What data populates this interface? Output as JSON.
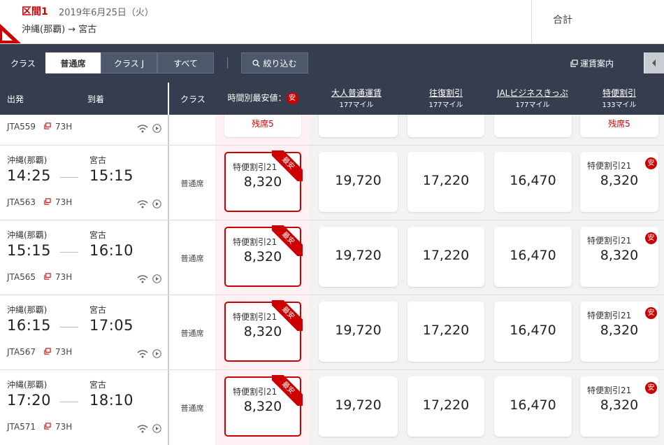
{
  "header": {
    "section": "区間1",
    "date": "2019年6月25日（火）",
    "route": "沖縄(那覇) → 宮古",
    "total_label": "合計"
  },
  "toolbar": {
    "class_label": "クラス",
    "class_options": [
      {
        "label": "普通席",
        "selected": true
      },
      {
        "label": "クラス J",
        "selected": false
      },
      {
        "label": "すべて",
        "selected": false
      }
    ],
    "filter_label": "絞り込む",
    "fare_info_label": "運賃案内"
  },
  "columns": {
    "depart": "出発",
    "arrive": "到着",
    "class": "クラス",
    "lowest": "時間別最安値：",
    "lowest_badge": "安",
    "fares": [
      {
        "name": "大人普通運賃",
        "miles": "177マイル"
      },
      {
        "name": "往復割引",
        "miles": "177マイル"
      },
      {
        "name": "JALビジネスきっぷ",
        "miles": "177マイル"
      },
      {
        "name": "特便割引",
        "miles": "133マイル"
      }
    ]
  },
  "partial_row": {
    "flight": "JTA559",
    "aircraft": "73H",
    "lowest_remaining": "残席5",
    "special_remaining": "残席5"
  },
  "flights": [
    {
      "from": "沖縄(那覇)",
      "to": "宮古",
      "dep": "14:25",
      "arr": "15:15",
      "flight": "JTA563",
      "aircraft": "73H",
      "seat_class": "普通席",
      "lowest_name": "特便割引21",
      "lowest_price": "8,320",
      "ribbon": "最安",
      "normal": "19,720",
      "roundtrip": "17,220",
      "business": "16,470",
      "special_name": "特便割引21",
      "special_badge": "安",
      "special_price": "8,320"
    },
    {
      "from": "沖縄(那覇)",
      "to": "宮古",
      "dep": "15:15",
      "arr": "16:10",
      "flight": "JTA565",
      "aircraft": "73H",
      "seat_class": "普通席",
      "lowest_name": "特便割引21",
      "lowest_price": "8,320",
      "ribbon": "最安",
      "normal": "19,720",
      "roundtrip": "17,220",
      "business": "16,470",
      "special_name": "特便割引21",
      "special_badge": "安",
      "special_price": "8,320"
    },
    {
      "from": "沖縄(那覇)",
      "to": "宮古",
      "dep": "16:15",
      "arr": "17:05",
      "flight": "JTA567",
      "aircraft": "73H",
      "seat_class": "普通席",
      "lowest_name": "特便割引21",
      "lowest_price": "8,320",
      "ribbon": "最安",
      "normal": "19,720",
      "roundtrip": "17,220",
      "business": "16,470",
      "special_name": "特便割引21",
      "special_badge": "安",
      "special_price": "8,320"
    },
    {
      "from": "沖縄(那覇)",
      "to": "宮古",
      "dep": "17:20",
      "arr": "18:10",
      "flight": "JTA571",
      "aircraft": "73H",
      "seat_class": "普通席",
      "lowest_name": "特便割引21",
      "lowest_price": "8,320",
      "ribbon": "最安",
      "normal": "19,720",
      "roundtrip": "17,220",
      "business": "16,470",
      "special_name": "特便割引21",
      "special_badge": "安",
      "special_price": "8,320"
    }
  ],
  "icons": {
    "aircraft": "aircraft-link-icon",
    "wifi": "wifi-icon",
    "entertainment": "play-icon",
    "fare_info": "external-window-icon",
    "filter": "search-icon",
    "collapse": "chevron-left-icon"
  },
  "colors": {
    "brand": "#cc0000",
    "toolbar": "#353d4e",
    "highlight": "#fdf1f3"
  }
}
